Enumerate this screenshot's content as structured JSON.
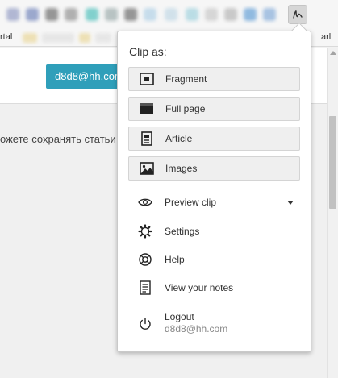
{
  "browser": {
    "bookmarks_left": "rtal",
    "bookmarks_right": "arl"
  },
  "page": {
    "user_button": "d8d8@hh.com",
    "body_text": "ожете сохранять статьи"
  },
  "popup": {
    "title": "Clip as:",
    "clip_options": [
      {
        "label": "Fragment",
        "icon": "fragment-icon"
      },
      {
        "label": "Full page",
        "icon": "full-page-icon"
      },
      {
        "label": "Article",
        "icon": "article-icon"
      },
      {
        "label": "Images",
        "icon": "images-icon"
      }
    ],
    "preview_label": "Preview clip",
    "menu": [
      {
        "label": "Settings",
        "icon": "gear-icon"
      },
      {
        "label": "Help",
        "icon": "lifebuoy-icon"
      },
      {
        "label": "View your notes",
        "icon": "notes-icon"
      }
    ],
    "logout": {
      "label": "Logout",
      "email": "d8d8@hh.com",
      "icon": "power-icon"
    }
  },
  "colors": {
    "user_button_bg": "#2f9fba",
    "clip_button_bg": "#efefef",
    "popup_bg": "#ffffff"
  }
}
